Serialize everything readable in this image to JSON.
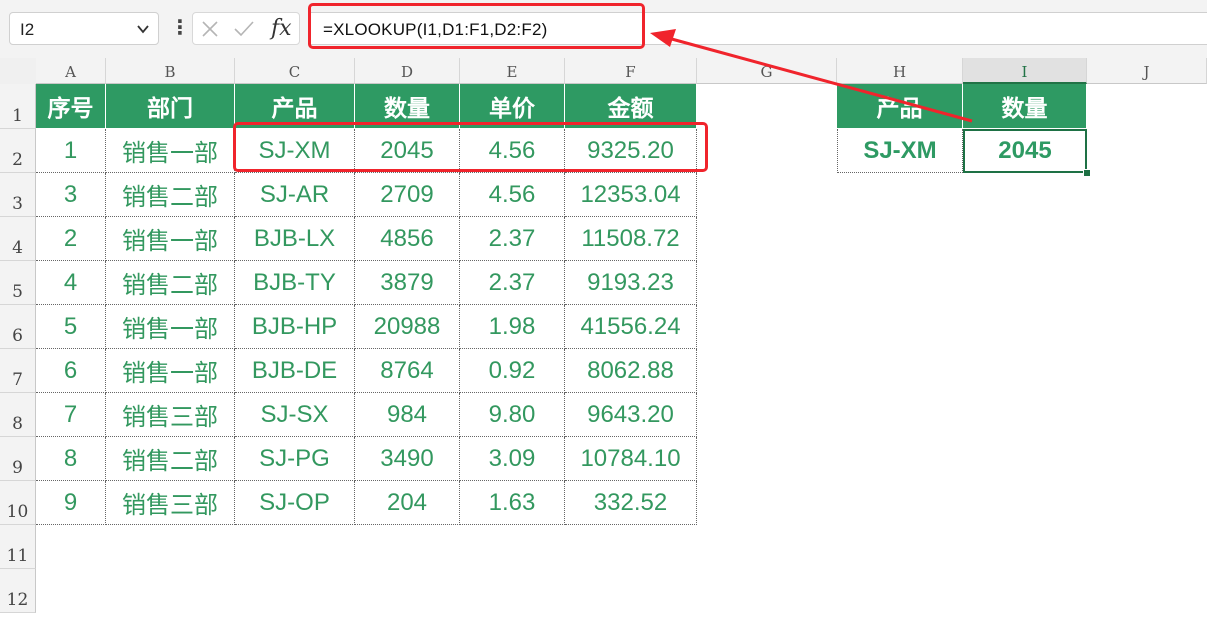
{
  "formula_bar": {
    "name_box": "I2",
    "formula": "=XLOOKUP(I1,D1:F1,D2:F2)",
    "fx_label": "fx"
  },
  "columns": [
    "A",
    "B",
    "C",
    "D",
    "E",
    "F",
    "G",
    "H",
    "I",
    "J"
  ],
  "rows": [
    "1",
    "2",
    "3",
    "4",
    "5",
    "6",
    "7",
    "8",
    "9",
    "10",
    "11",
    "12"
  ],
  "table": {
    "headers": [
      "序号",
      "部门",
      "产品",
      "数量",
      "单价",
      "金额"
    ],
    "rows": [
      [
        "1",
        "销售一部",
        "SJ-XM",
        "2045",
        "4.56",
        "9325.20"
      ],
      [
        "3",
        "销售二部",
        "SJ-AR",
        "2709",
        "4.56",
        "12353.04"
      ],
      [
        "2",
        "销售一部",
        "BJB-LX",
        "4856",
        "2.37",
        "11508.72"
      ],
      [
        "4",
        "销售二部",
        "BJB-TY",
        "3879",
        "2.37",
        "9193.23"
      ],
      [
        "5",
        "销售一部",
        "BJB-HP",
        "20988",
        "1.98",
        "41556.24"
      ],
      [
        "6",
        "销售一部",
        "BJB-DE",
        "8764",
        "0.92",
        "8062.88"
      ],
      [
        "7",
        "销售三部",
        "SJ-SX",
        "984",
        "9.80",
        "9643.20"
      ],
      [
        "8",
        "销售二部",
        "SJ-PG",
        "3490",
        "3.09",
        "10784.10"
      ],
      [
        "9",
        "销售三部",
        "SJ-OP",
        "204",
        "1.63",
        "332.52"
      ]
    ]
  },
  "lookup": {
    "h1": "产品",
    "i1": "数量",
    "h2": "SJ-XM",
    "i2": "2045"
  },
  "colors": {
    "header_fill": "#2e9a63",
    "text_green": "#33985f",
    "highlight_red": "#f0242c",
    "selection_border": "#1e7145"
  },
  "icons": [
    "chevron-down-icon",
    "more-dots-icon",
    "cancel-icon",
    "enter-check-icon",
    "fx-icon"
  ]
}
